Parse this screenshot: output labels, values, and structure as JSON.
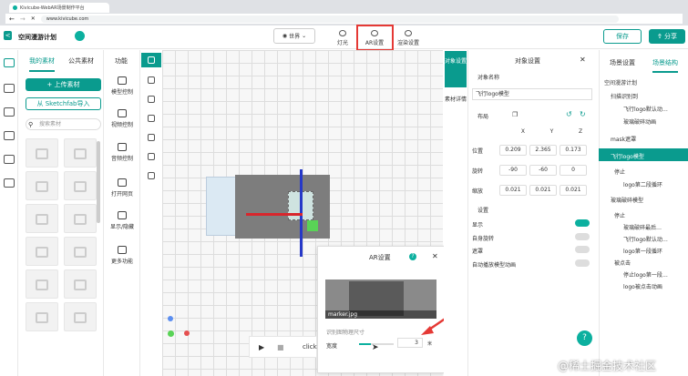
{
  "browser": {
    "tab_title": "Kivicube-WebAR场景制作平台",
    "url": "www.kivicube.com"
  },
  "header": {
    "back": "<",
    "project_title": "空间漫游计划",
    "world_label": "世界",
    "tools": [
      "灯光",
      "AR设置",
      "渲染设置"
    ],
    "save": "保存",
    "share": "分享"
  },
  "materials": {
    "tab_mine": "我的素材",
    "tab_public": "公共素材",
    "upload": "+ 上传素材",
    "sketchfab": "从 Sketchfab导入",
    "search_placeholder": "搜索素材"
  },
  "functions": {
    "title": "功能",
    "items": [
      "模型控制",
      "视频控制",
      "音频控制",
      "打开网页",
      "显示/隐藏",
      "更多功能"
    ]
  },
  "ar_popup": {
    "title": "AR设置",
    "image_name": "marker.jpg",
    "size_label": "识别图物理尺寸",
    "width_label": "宽度",
    "width_value": "3",
    "width_unit": "米",
    "slider_fraction": 0.35
  },
  "playbar": {
    "text": "click"
  },
  "side_tabs": [
    "对象设置",
    "素材详情"
  ],
  "object_settings": {
    "title": "对象设置",
    "name_label": "对象名称",
    "name_value": "飞行logo模型",
    "layout_label": "布局",
    "axes": [
      "X",
      "Y",
      "Z"
    ],
    "rows": [
      {
        "label": "位置",
        "values": [
          "0.209",
          "2.365",
          "0.173"
        ]
      },
      {
        "label": "旋转",
        "values": [
          "-90",
          "-60",
          "0"
        ]
      },
      {
        "label": "缩放",
        "values": [
          "0.021",
          "0.021",
          "0.021"
        ]
      }
    ],
    "settings_label": "设置",
    "toggles": [
      {
        "label": "显示",
        "on": true
      },
      {
        "label": "自身旋转",
        "on": false
      },
      {
        "label": "遮罩",
        "on": false
      },
      {
        "label": "自动播放模型动画",
        "on": false
      }
    ]
  },
  "scene": {
    "tab_settings": "场景设置",
    "tab_structure": "场景结构",
    "tree": [
      "空间漫游计划",
      "扫描识别到",
      "飞行logo默认动…",
      "玻璃破碎动画",
      "mask遮罩",
      "飞行logo模型",
      "停止",
      "logo第二段循环",
      "玻璃破碎模型",
      "停止",
      "玻璃破碎最后…",
      "飞行logo默认动…",
      "logo第一段循环",
      "被点击",
      "停止logo第一段…",
      "logo被点击动画"
    ]
  },
  "watermark": "@稀土掘金技术社区",
  "colors": {
    "accent": "#0a9b8e",
    "highlight": "#e53935"
  }
}
